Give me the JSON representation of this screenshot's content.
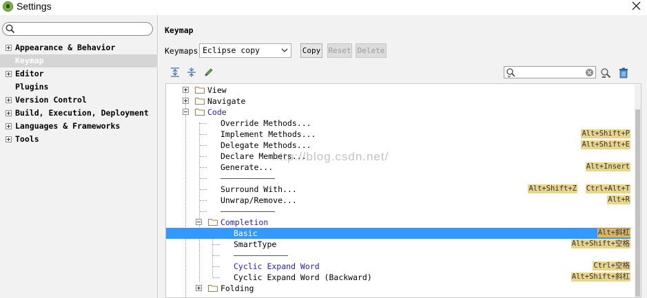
{
  "window": {
    "title": "Settings"
  },
  "nav": {
    "items": [
      {
        "label": "Appearance & Behavior",
        "expandable": true,
        "selected": false
      },
      {
        "label": "Keymap",
        "expandable": false,
        "selected": true
      },
      {
        "label": "Editor",
        "expandable": true,
        "selected": false
      },
      {
        "label": "Plugins",
        "expandable": false,
        "selected": false
      },
      {
        "label": "Version Control",
        "expandable": true,
        "selected": false
      },
      {
        "label": "Build, Execution, Deployment",
        "expandable": true,
        "selected": false
      },
      {
        "label": "Languages & Frameworks",
        "expandable": true,
        "selected": false
      },
      {
        "label": "Tools",
        "expandable": true,
        "selected": false
      }
    ]
  },
  "keymap": {
    "heading": "Keymap",
    "keymaps_label": "Keymaps:",
    "selected_keymap": "Eclipse copy",
    "buttons": {
      "copy": "Copy",
      "reset": "Reset",
      "delete": "Delete"
    }
  },
  "tree": {
    "view": "View",
    "navigate": "Navigate",
    "code": "Code",
    "override_methods": "Override Methods...",
    "implement_methods": "Implement Methods...",
    "implement_methods_sc": "Alt+Shift+P",
    "delegate_methods": "Delegate Methods...",
    "delegate_methods_sc": "Alt+Shift+E",
    "declare_members": "Declare Members...",
    "generate": "Generate...",
    "generate_sc": "Alt+Insert",
    "surround_with": "Surround With...",
    "surround_with_sc1": "Alt+Shift+Z",
    "surround_with_sc2": "Ctrl+Alt+T",
    "unwrap_remove": "Unwrap/Remove...",
    "unwrap_remove_sc": "Alt+R",
    "completion": "Completion",
    "basic": "Basic",
    "basic_sc": "Alt+斜杠",
    "smart_type": "SmartType",
    "smart_type_sc": "Alt+Shift+空格",
    "cyclic_expand": "Cyclic Expand Word",
    "cyclic_expand_sc": "Ctrl+空格",
    "cyclic_expand_back": "Cyclic Expand Word (Backward)",
    "cyclic_expand_back_sc": "Alt+Shift+斜杠",
    "folding": "Folding"
  },
  "watermark": "http://blog.csdn.net/"
}
